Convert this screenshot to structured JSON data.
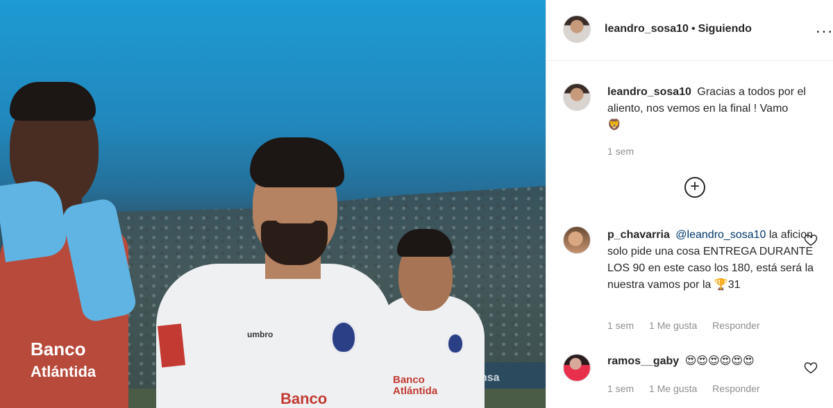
{
  "header": {
    "username": "leandro_sosa10",
    "separator": "•",
    "follow_status": "Siguiendo",
    "more_icon": "..."
  },
  "caption": {
    "username": "leandro_sosa10",
    "text": "Gracias a todos por el aliento, nos vemos en la final ! Vamo",
    "emoji": "🦁",
    "time": "1 sem"
  },
  "load_more_icon": "+",
  "comments": [
    {
      "username": "p_chavarria",
      "mention": "@leandro_sosa10",
      "text": "la aficion solo pide una cosa ENTREGA DURANTE LOS 90 en este caso los 180, está será la nuestra vamos por la",
      "emoji": "🏆",
      "suffix": "31",
      "time": "1 sem",
      "likes": "1 Me gusta",
      "reply": "Responder"
    },
    {
      "username": "ramos__gaby",
      "text": "😍😍😍😍😍😍",
      "time": "1 sem",
      "likes": "1 Me gusta",
      "reply": "Responder"
    }
  ],
  "photo": {
    "sponsor_1": "Banco",
    "sponsor_1b": "Atlántida",
    "sponsor_2": "Banco",
    "sponsor_3": "Banco",
    "sponsor_3b": "Atlántida",
    "kit_brand": "umbro",
    "board_text": "nsa"
  },
  "colors": {
    "mention": "#00376b",
    "meta": "#8e8e8e",
    "text": "#262626"
  }
}
